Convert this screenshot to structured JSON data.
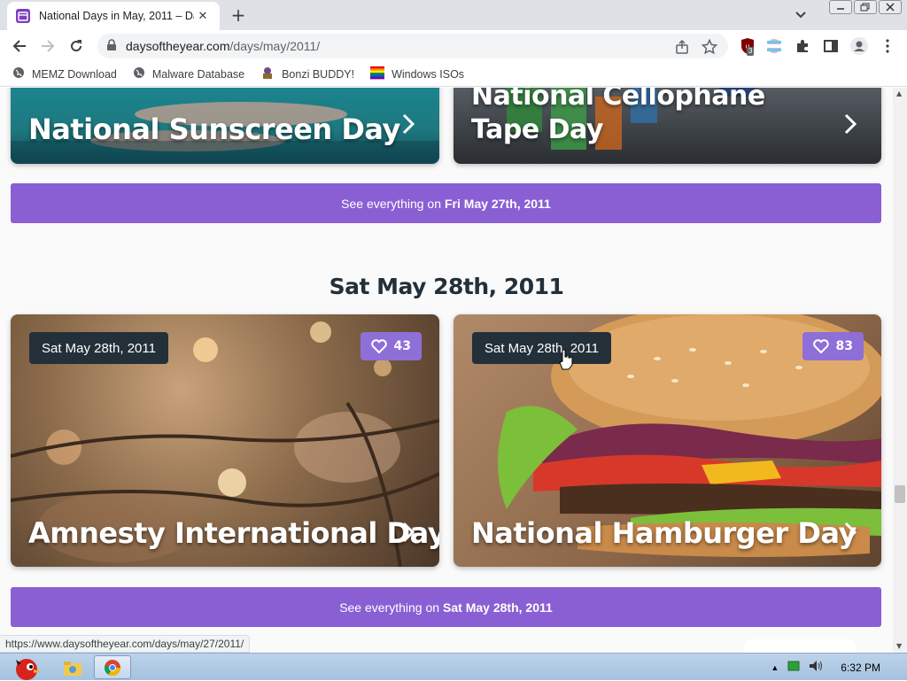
{
  "browser": {
    "tab_title": "National Days in May, 2011 – Da",
    "url_host": "daysoftheyear.com",
    "url_path": "/days/may/2011/",
    "extension_badge": "3",
    "bookmarks": [
      {
        "label": "MEMZ Download",
        "icon": "globe-icon"
      },
      {
        "label": "Malware Database",
        "icon": "globe-icon"
      },
      {
        "label": "Bonzi BUDDY!",
        "icon": "bonzi-icon"
      },
      {
        "label": "Windows ISOs",
        "icon": "windows-flag-icon"
      }
    ],
    "status_url": "https://www.daysoftheyear.com/days/may/27/2011/"
  },
  "page": {
    "top_cards": [
      {
        "title": "National Sunscreen Day",
        "image": "sunscreen-hand-photo"
      },
      {
        "title_line1": "National Cellophane",
        "title_line2": "Tape Day",
        "image": "tape-dispensers-photo"
      }
    ],
    "see_bar_1": {
      "prefix": "See everything on",
      "date": "Fri May 27th, 2011"
    },
    "section_heading": "Sat May 28th, 2011",
    "cards": [
      {
        "date": "Sat May 28th, 2011",
        "likes": "43",
        "title": "Amnesty International Day",
        "image": "candles-barbed-wire-photo"
      },
      {
        "date": "Sat May 28th, 2011",
        "likes": "83",
        "title": "National Hamburger Day",
        "image": "hamburger-photo"
      }
    ],
    "see_bar_2": {
      "prefix": "See everything on",
      "date": "Sat May 28th, 2011"
    }
  },
  "taskbar": {
    "clock": "6:32 PM"
  },
  "colors": {
    "accent_purple": "#8a5fd4",
    "like_chip": "#8e6fd8",
    "chip_dark": "#233039"
  }
}
